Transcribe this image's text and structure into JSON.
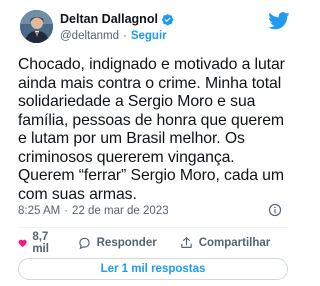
{
  "author": {
    "display_name": "Deltan Dallagnol",
    "handle": "@deltanmd",
    "separator": "·",
    "follow_label": "Seguir"
  },
  "tweet": {
    "text": "Chocado, indignado e motivado a lutar\nainda mais contra o crime. Minha total\nsolidariedade a Sergio Moro e sua\nfamília, pessoas de honra que querem\ne lutam por um Brasil melhor. Os\ncriminosos quererem vingança.\nQuerem “ferrar” Sergio Moro, cada um\ncom suas armas.",
    "time": "8:25 AM",
    "separator": "·",
    "date": "22 de mar de 2023"
  },
  "actions": {
    "likes": "8,7 mil",
    "reply_label": "Responder",
    "share_label": "Compartilhar"
  },
  "read_replies_label": "Ler 1 mil respostas",
  "colors": {
    "accent": "#1d9bf0",
    "like": "#f91880",
    "text": "#0f1419",
    "muted": "#536471"
  },
  "icons": [
    "verified-badge-icon",
    "twitter-bird-icon",
    "info-icon",
    "heart-icon",
    "reply-icon",
    "share-icon"
  ]
}
